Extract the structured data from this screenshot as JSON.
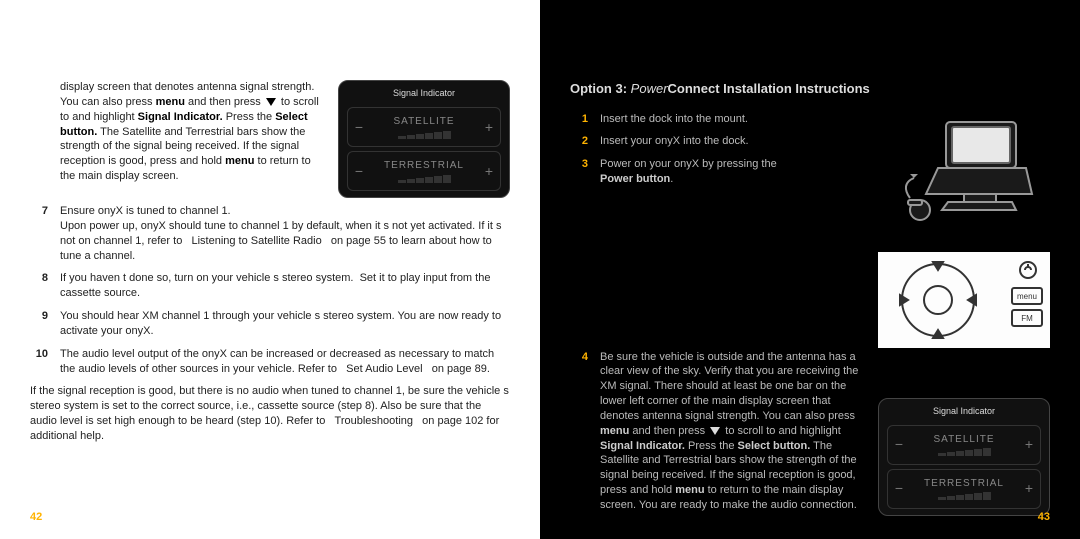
{
  "left": {
    "items_first": [
      {
        "num": "",
        "html": "display screen that denotes antenna signal strength. You can also press <b>menu</b> and then press <span class=\"down-tri\"></span> to scroll to and highlight <b>Signal Indicator.</b> Press the <b>Select button.</b> The Satellite and Terrestrial bars show the strength of the signal being received. If the signal reception is good, press and hold <b>menu</b> to return to the main display screen."
      },
      {
        "num": "7",
        "html": "Ensure onyX is tuned to channel 1.<br>Upon power up, onyX should tune to channel 1 by default, when it s not yet activated. If it s not on channel 1, refer to &nbsp;&nbsp;Listening to Satellite Radio &nbsp;&nbsp;on page 55 to learn about how to tune a channel."
      },
      {
        "num": "8",
        "html": "If you haven t done so, turn on your vehicle s stereo system. &nbsp;Set it to play input from the cassette source."
      },
      {
        "num": "9",
        "html": "You should hear XM channel 1 through your vehicle s stereo system. You are now ready to activate your onyX."
      },
      {
        "num": "10",
        "html": "The audio level output of the onyX can be increased or decreased as necessary to match the audio levels of other sources in your vehicle. Refer to &nbsp;&nbsp;Set Audio Level &nbsp;&nbsp;on page 89."
      }
    ],
    "para": "If the signal reception is good, but there is no audio when tuned to channel 1, be sure the vehicle s stereo system is set to the correct source, i.e., cassette source (step 8). Also be sure that the audio level is set high enough to be heard (step 10). Refer to &nbsp;&nbsp;Troubleshooting &nbsp;&nbsp;on page 102 for additional help.",
    "signal_title": "Signal Indicator",
    "sat_label": "SATELLITE",
    "ter_label": "TERRESTRIAL",
    "page_num": "42"
  },
  "right": {
    "heading_prefix": "Option 3:",
    "heading_italic": "Power",
    "heading_bold": "Connect Installation Instructions",
    "items_top": [
      {
        "num": "1",
        "html": "Insert the dock into the mount."
      },
      {
        "num": "2",
        "html": "Insert your onyX into the dock."
      },
      {
        "num": "3",
        "html": "Power on your onyX by pressing the <b>Power button</b>."
      }
    ],
    "item4": {
      "num": "4",
      "html": "Be sure the vehicle is outside and the antenna has a clear view of the sky. Verify that you are receiving the XM signal. There should at least be one bar on the lower left corner of the main display screen that denotes antenna signal strength. You can also press <b>menu</b> and then press <span class=\"down-tri\"></span> to scroll to and highlight <b>Signal Indicator.</b> Press the <b>Select button.</b> The Satellite and Terrestrial bars show the strength of the signal being received. If the signal reception is good, press and hold <b>menu</b> to return to the main display screen. You are ready to make the audio connection."
    },
    "signal_title": "Signal Indicator",
    "sat_label": "SATELLITE",
    "ter_label": "TERRESTRIAL",
    "radio_btn1": "menu",
    "radio_btn2": "FM",
    "page_num": "43"
  }
}
